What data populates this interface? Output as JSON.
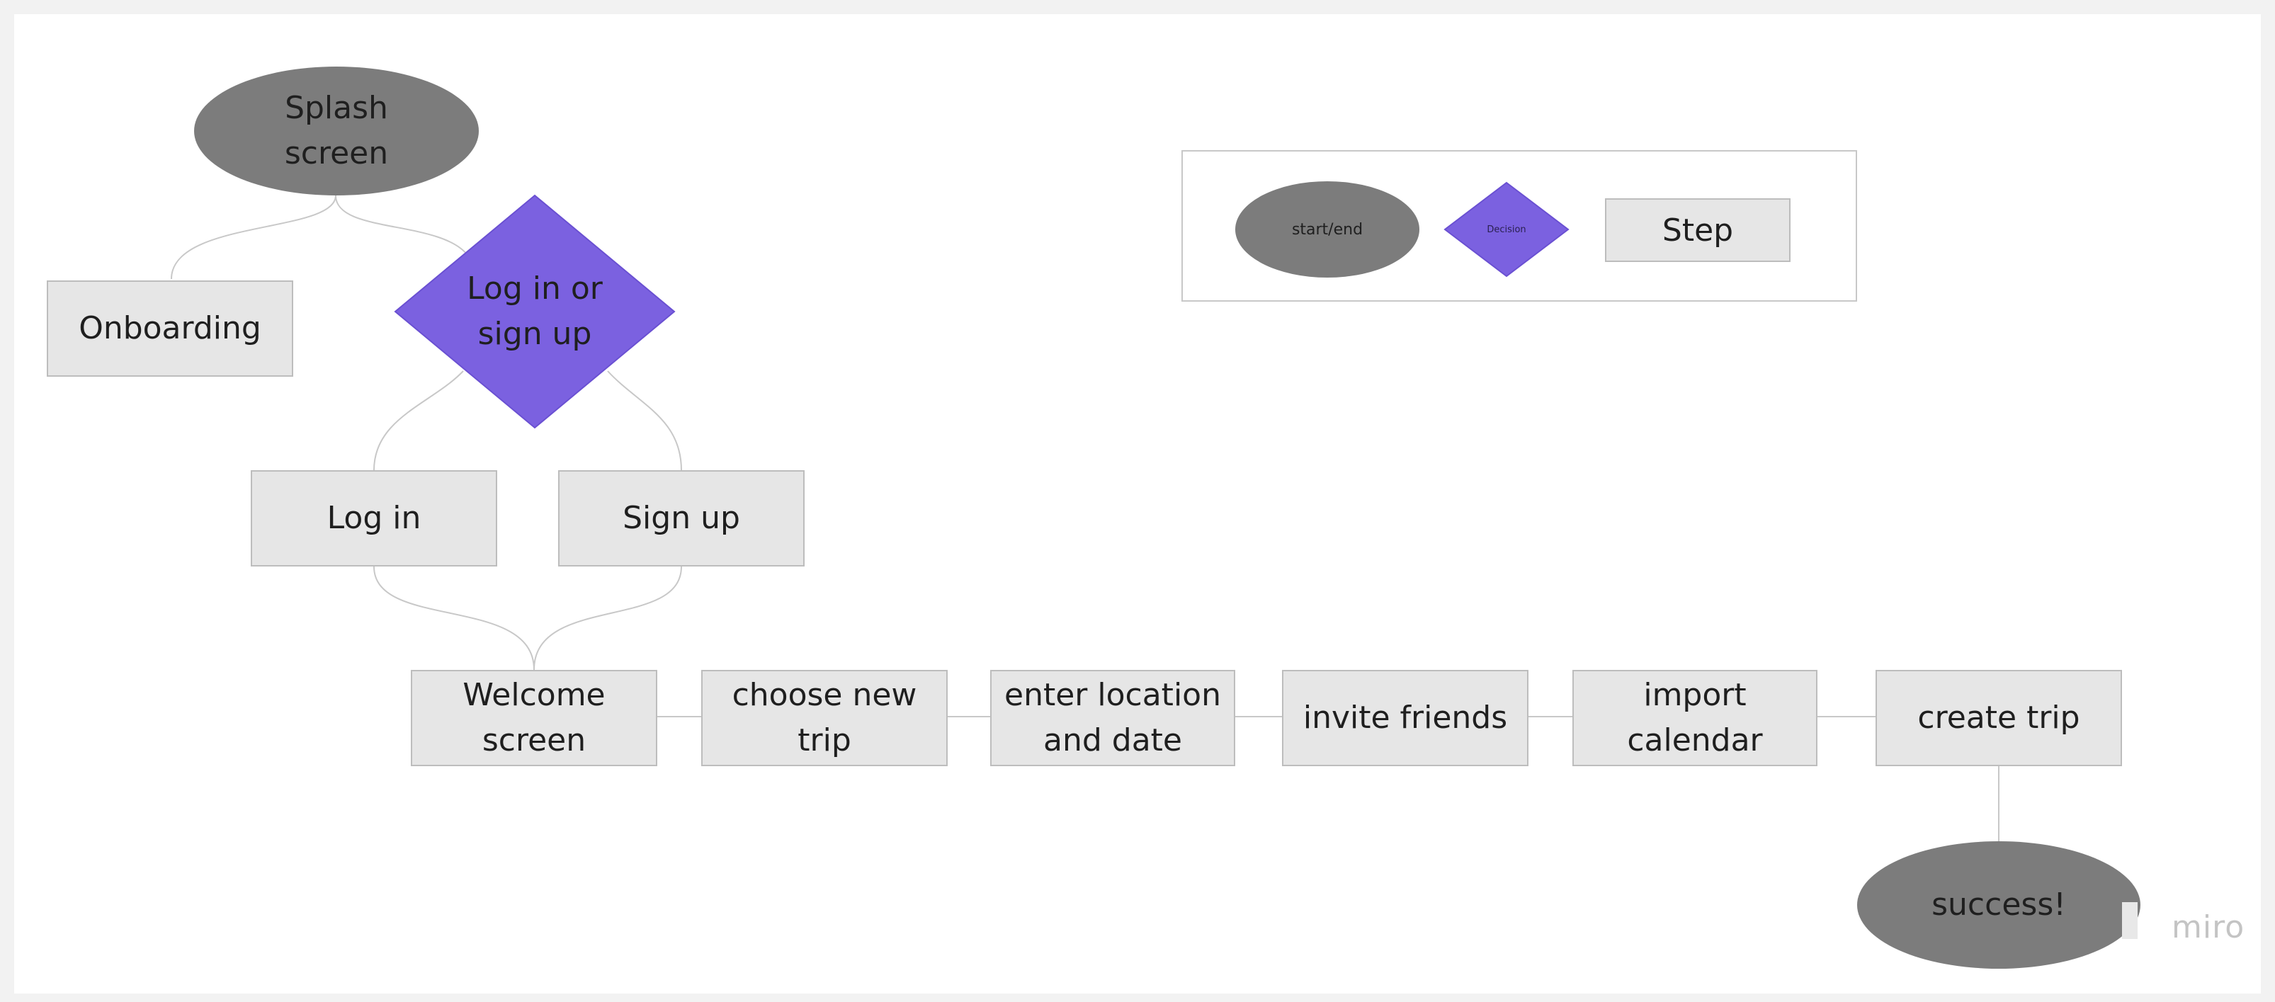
{
  "flowchart": {
    "splash": "Splash\nscreen",
    "onboarding": "Onboarding",
    "decision": "Log in or\nsign up",
    "login": "Log in",
    "signup": "Sign up",
    "welcome": "Welcome\nscreen",
    "choose_trip": "choose new\ntrip",
    "enter_location": "enter location\nand date",
    "invite_friends": "invite friends",
    "import_calendar": "import\ncalendar",
    "create_trip": "create trip",
    "success": "success!"
  },
  "legend": {
    "start_end": "start/end",
    "decision": "Decision",
    "step": "Step"
  },
  "watermark": "miro",
  "colors": {
    "canvas": "#ffffff",
    "background": "#f2f2f2",
    "step_fill": "#e6e6e6",
    "step_border": "#bdbdbd",
    "oval_fill": "#7c7c7c",
    "decision_fill": "#7b61e0",
    "connector": "#c8c8c8"
  }
}
